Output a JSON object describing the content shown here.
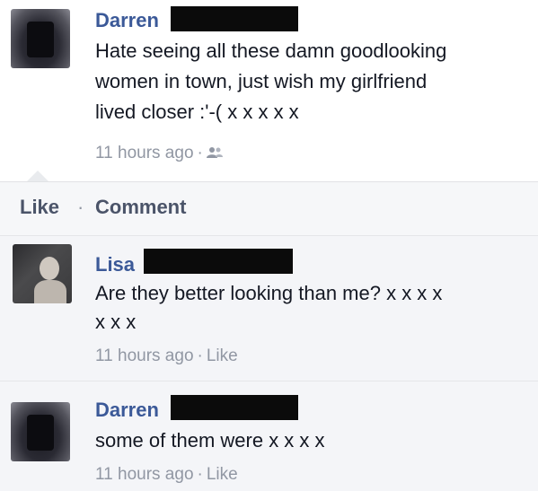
{
  "post": {
    "author": "Darren",
    "text_line1": "Hate seeing all these damn goodlooking",
    "text_line2": "women in town, just wish my girlfriend",
    "text_line3": "lived closer :'-( x x x x x",
    "time": "11 hours ago",
    "audience_icon": "friends-icon"
  },
  "actions": {
    "like": "Like",
    "separator": "·",
    "comment": "Comment"
  },
  "comments": [
    {
      "author": "Lisa",
      "text_line1": "Are they better looking than me? x x x x",
      "text_line2": "x x x",
      "time": "11 hours ago",
      "like": "Like"
    },
    {
      "author": "Darren",
      "text_line1": "some of them were x x x x",
      "time": "11 hours ago",
      "like": "Like"
    }
  ]
}
